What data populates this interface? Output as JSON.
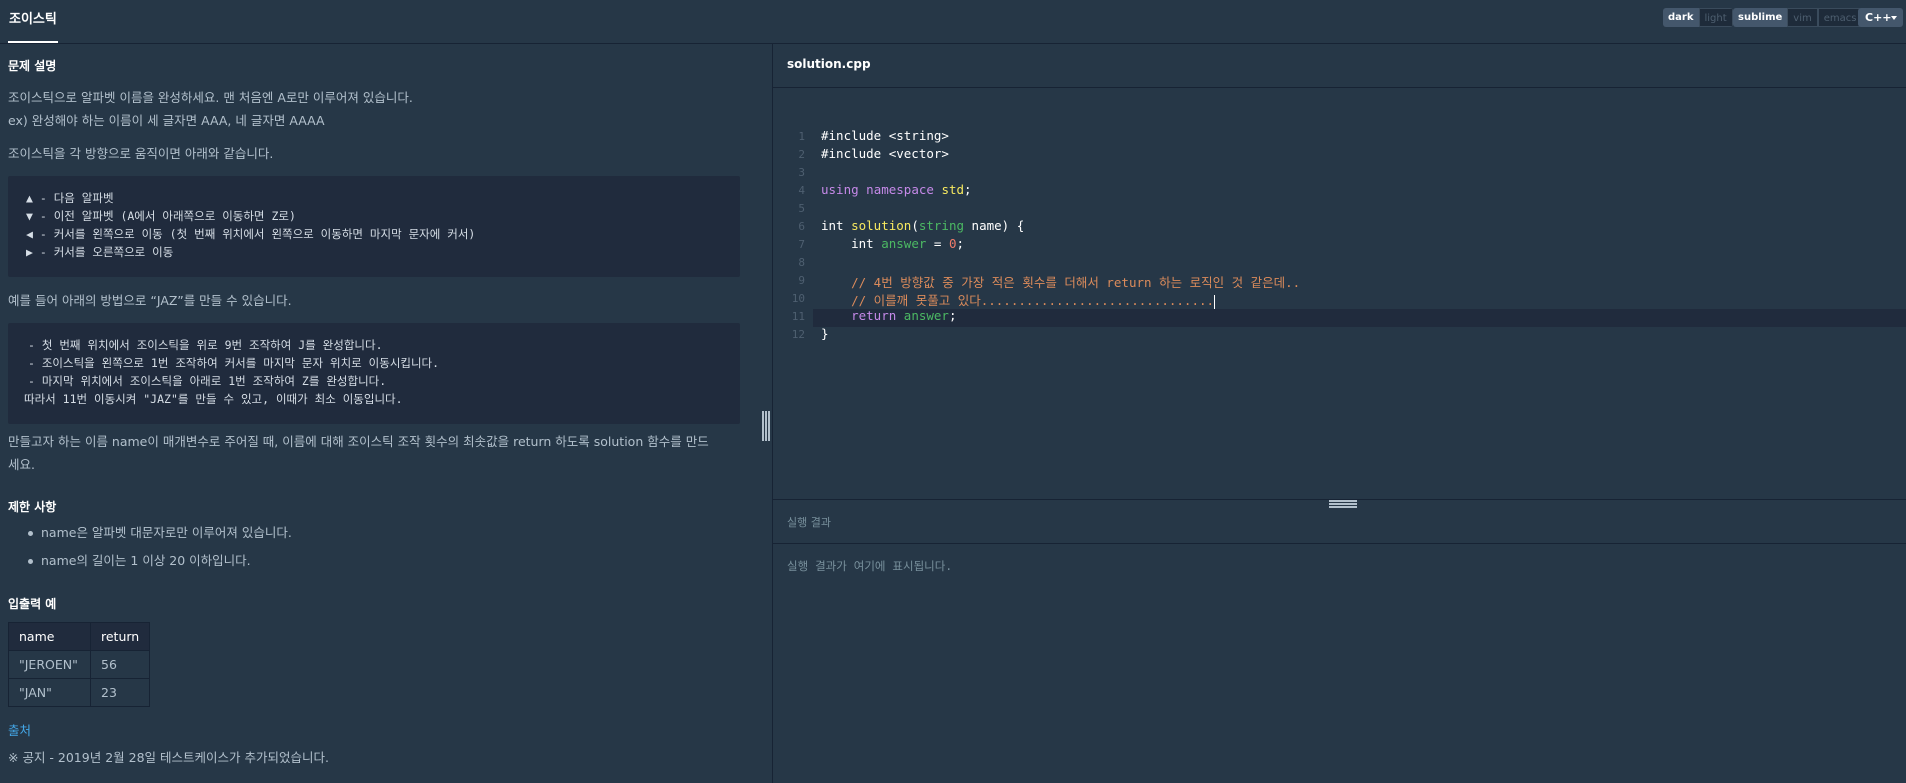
{
  "header": {
    "title": "조이스틱",
    "theme": {
      "dark": "dark",
      "light": "light"
    },
    "keymap": {
      "sublime": "sublime",
      "vim": "vim",
      "emacs": "emacs"
    },
    "language": "C++"
  },
  "problem": {
    "desc_heading": "문제 설명",
    "desc_line1": "조이스틱으로 알파벳 이름을 완성하세요. 맨 처음엔 A로만 이루어져 있습니다.",
    "desc_line2": "ex) 완성해야 하는 이름이 세 글자면 AAA, 네 글자면 AAAA",
    "move_intro": "조이스틱을 각 방향으로 움직이면 아래와 같습니다.",
    "move_lines": [
      "▲ - 다음 알파벳",
      "▼ - 이전 알파벳 (A에서 아래쪽으로 이동하면 Z로)",
      "◀ - 커서를 왼쪽으로 이동 (첫 번째 위치에서 왼쪽으로 이동하면 마지막 문자에 커서)",
      "▶ - 커서를 오른쪽으로 이동"
    ],
    "example_intro": "예를 들어 아래의 방법으로 “JAZ”를 만들 수 있습니다.",
    "example_lines": [
      "- 첫 번째 위치에서 조이스틱을 위로 9번 조작하여 J를 완성합니다.",
      "- 조이스틱을 왼쪽으로 1번 조작하여 커서를 마지막 문자 위치로 이동시킵니다.",
      "- 마지막 위치에서 조이스틱을 아래로 1번 조작하여 Z를 완성합니다.",
      "따라서 11번 이동시켜 \"JAZ\"를 만들 수 있고, 이때가 최소 이동입니다."
    ],
    "task_line1": "만들고자 하는 이름 name이 매개변수로 주어질 때, 이름에 대해 조이스틱 조작 횟수의 최솟값을 return 하도록 solution 함수를 만드",
    "task_line2": "세요.",
    "limits_heading": "제한 사항",
    "limits": [
      "name은 알파벳 대문자로만 이루어져 있습니다.",
      "name의 길이는 1 이상 20 이하입니다."
    ],
    "io_heading": "입출력 예",
    "io_table": {
      "headers": [
        "name",
        "return"
      ],
      "rows": [
        [
          "\"JEROEN\"",
          "56"
        ],
        [
          "\"JAN\"",
          "23"
        ]
      ]
    },
    "source_link": "출처",
    "notice": "※ 공지 - 2019년 2월 28일 테스트케이스가 추가되었습니다."
  },
  "editor": {
    "filename": "solution.cpp",
    "line_numbers": [
      "1",
      "2",
      "3",
      "4",
      "5",
      "6",
      "7",
      "8",
      "9",
      "10",
      "11",
      "12"
    ],
    "code": {
      "l1": "#include <string>",
      "l2": "#include <vector>",
      "l4_kw1": "using",
      "l4_kw2": "namespace",
      "l4_ns": "std",
      "l4_end": ";",
      "l6_int": "int ",
      "l6_fn": "solution",
      "l6_open": "(",
      "l6_type": "string",
      "l6_rest": " name) {",
      "l7_int": "    int ",
      "l7_var": "answer",
      "l7_eq": " = ",
      "l7_num": "0",
      "l7_end": ";",
      "l9": "    // 4번 방향값 중 가장 적은 횟수를 더해서 return 하는 로직인 것 같은데..",
      "l10": "    // 이를깨 못풀고 있다...............................",
      "l11_kw": "    return ",
      "l11_var": "answer",
      "l11_end": ";",
      "l12": "}"
    }
  },
  "result": {
    "heading": "실행 결과",
    "placeholder": "실행 결과가 여기에 표시됩니다."
  }
}
